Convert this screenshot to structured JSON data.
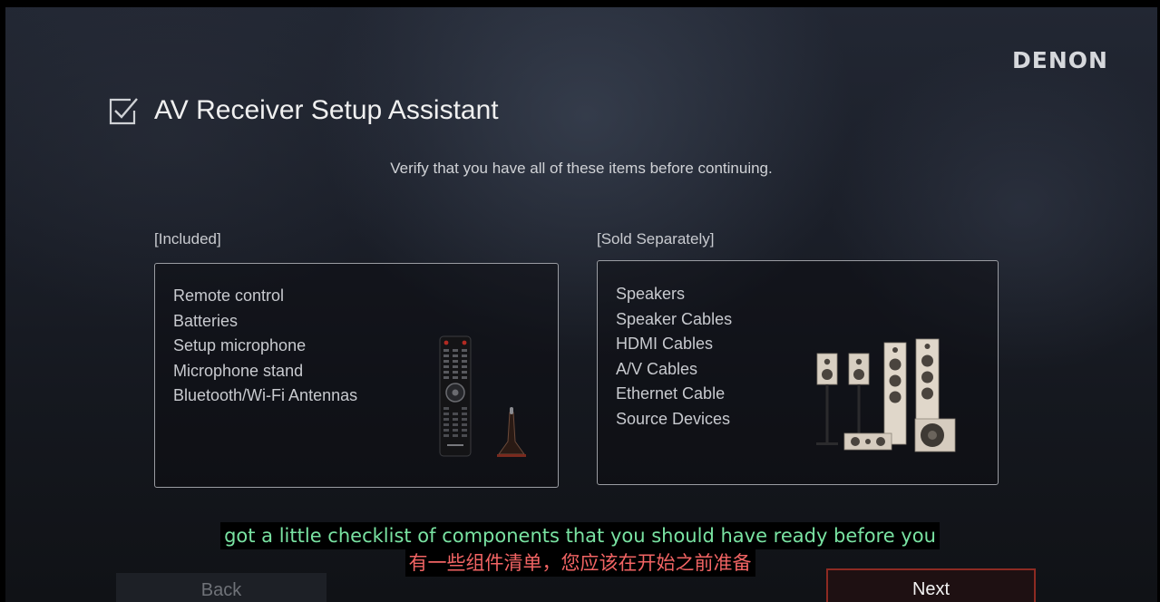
{
  "brand": "DENON",
  "header": {
    "title": "AV Receiver Setup Assistant",
    "subtitle": "Verify that you have all of these items before continuing."
  },
  "included": {
    "label": "[Included]",
    "items": [
      "Remote control",
      "Batteries",
      "Setup microphone",
      "Microphone stand",
      "Bluetooth/Wi-Fi Antennas"
    ],
    "illustration": "remote-and-microphone"
  },
  "sold_separately": {
    "label": "[Sold Separately]",
    "items": [
      "Speakers",
      "Speaker Cables",
      "HDMI Cables",
      "A/V Cables",
      "Ethernet Cable",
      "Source Devices"
    ],
    "illustration": "speaker-set"
  },
  "buttons": {
    "back": "Back",
    "next": "Next"
  },
  "captions": {
    "english": "got a little checklist of components that you should have ready before you",
    "chinese": "有一些组件清单，您应该在开始之前准备"
  },
  "colors": {
    "accent": "#8d2a22",
    "caption_english": "#79e3a2",
    "caption_chinese": "#f26464"
  }
}
